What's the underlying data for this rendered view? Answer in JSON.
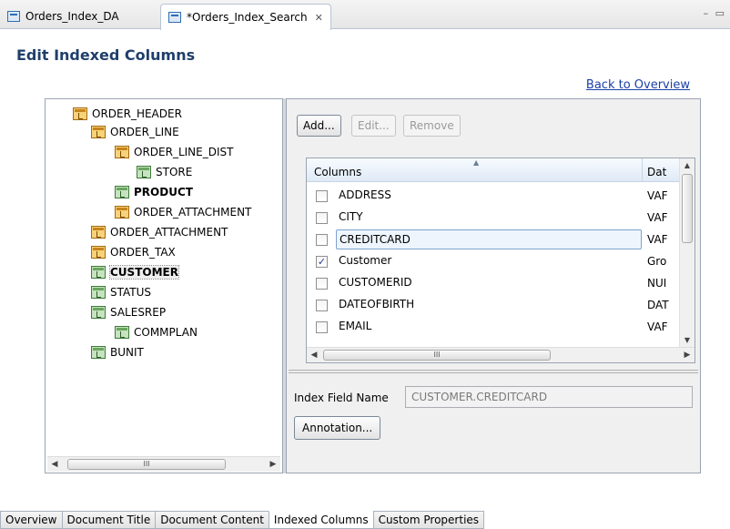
{
  "editor_tabs": [
    {
      "label": "Orders_Index_DA",
      "active": false
    },
    {
      "label": "*Orders_Index_Search",
      "active": true,
      "close": "✕"
    }
  ],
  "window_controls": "– ▭",
  "page_title": "Edit Indexed Columns",
  "back_link": "Back to Overview",
  "tree": {
    "nodes": [
      {
        "label": "ORDER_HEADER",
        "icon": "table-icon",
        "bold": false
      },
      {
        "label": "ORDER_LINE",
        "icon": "table-icon",
        "bold": false
      },
      {
        "label": "ORDER_LINE_DIST",
        "icon": "table-icon",
        "bold": false
      },
      {
        "label": "STORE",
        "icon": "group-icon",
        "bold": false
      },
      {
        "label": "PRODUCT",
        "icon": "group-icon",
        "bold": true
      },
      {
        "label": "ORDER_ATTACHMENT",
        "icon": "table-icon",
        "bold": false
      },
      {
        "label": "ORDER_ATTACHMENT",
        "icon": "table-icon",
        "bold": false
      },
      {
        "label": "ORDER_TAX",
        "icon": "table-icon",
        "bold": false
      },
      {
        "label": "CUSTOMER",
        "icon": "group-icon",
        "bold": true,
        "selected": true
      },
      {
        "label": "STATUS",
        "icon": "group-icon",
        "bold": false
      },
      {
        "label": "SALESREP",
        "icon": "group-icon",
        "bold": false
      },
      {
        "label": "COMMPLAN",
        "icon": "group-icon",
        "bold": false
      },
      {
        "label": "BUNIT",
        "icon": "group-icon",
        "bold": false
      }
    ],
    "scroll_grip": "III"
  },
  "buttons": {
    "add": "Add...",
    "edit": "Edit...",
    "remove": "Remove"
  },
  "columns_table": {
    "headers": [
      "Columns",
      "Dat"
    ],
    "rows": [
      {
        "name": "ADDRESS",
        "type": "VAF",
        "checked": false
      },
      {
        "name": "CITY",
        "type": "VAF",
        "checked": false
      },
      {
        "name": "CREDITCARD",
        "type": "VAF",
        "checked": false,
        "selected": true
      },
      {
        "name": "Customer",
        "type": "Gro",
        "checked": true
      },
      {
        "name": "CUSTOMERID",
        "type": "NUI",
        "checked": false
      },
      {
        "name": "DATEOFBIRTH",
        "type": "DAT",
        "checked": false
      },
      {
        "name": "EMAIL",
        "type": "VAF",
        "checked": false
      }
    ],
    "scroll_grip": "III"
  },
  "index_field": {
    "label": "Index Field Name",
    "value": "CUSTOMER.CREDITCARD"
  },
  "annotation_button": "Annotation...",
  "bottom_tabs": [
    {
      "label": "Overview",
      "active": false
    },
    {
      "label": "Document Title",
      "active": false
    },
    {
      "label": "Document Content",
      "active": false
    },
    {
      "label": "Indexed Columns",
      "active": true
    },
    {
      "label": "Custom Properties",
      "active": false
    }
  ]
}
